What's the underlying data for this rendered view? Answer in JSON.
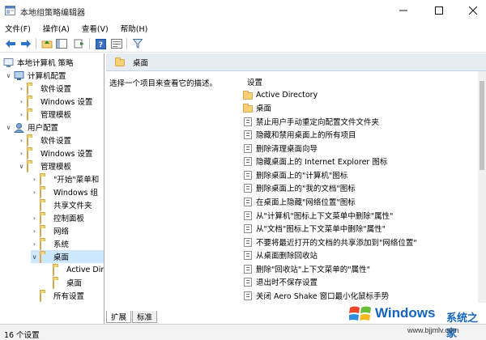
{
  "window": {
    "title": "本地组策略编辑器"
  },
  "menu": [
    "文件(F)",
    "操作(A)",
    "查看(V)",
    "帮助(H)"
  ],
  "tree": {
    "root": "本地计算机 策略",
    "computer_config": "计算机配置",
    "cc_software": "软件设置",
    "cc_windows": "Windows 设置",
    "cc_admin": "管理模板",
    "user_config": "用户配置",
    "uc_software": "软件设置",
    "uc_windows": "Windows 设置",
    "uc_admin": "管理模板",
    "start_menu": "\"开始\"菜单和",
    "windows_components": "Windows 组",
    "shared_folders": "共享文件夹",
    "control_panel": "控制面板",
    "network": "网络",
    "system": "系统",
    "desktop": "桌面",
    "active_dir": "Active Dir",
    "desktop_sub": "桌面",
    "all_settings": "所有设置"
  },
  "header": {
    "title": "桌面"
  },
  "description": "选择一个项目来查看它的描述。",
  "settings": {
    "column_header": "设置",
    "items": [
      {
        "icon": "folder",
        "label": "Active Directory"
      },
      {
        "icon": "folder",
        "label": "桌面"
      },
      {
        "icon": "policy",
        "label": "禁止用户手动重定向配置文件文件夹"
      },
      {
        "icon": "policy",
        "label": "隐藏和禁用桌面上的所有项目"
      },
      {
        "icon": "policy",
        "label": "删除清理桌面向导"
      },
      {
        "icon": "policy",
        "label": "隐藏桌面上的 Internet Explorer 图标"
      },
      {
        "icon": "policy",
        "label": "删除桌面上的\"计算机\"图标"
      },
      {
        "icon": "policy",
        "label": "删除桌面上的\"我的文档\"图标"
      },
      {
        "icon": "policy",
        "label": "在桌面上隐藏\"网络位置\"图标"
      },
      {
        "icon": "policy",
        "label": "从\"计算机\"图标上下文菜单中删除\"属性\""
      },
      {
        "icon": "policy",
        "label": "从\"文档\"图标上下文菜单中删除\"属性\""
      },
      {
        "icon": "policy",
        "label": "不要将最近打开的文档的共享添加到\"网络位置\""
      },
      {
        "icon": "policy",
        "label": "从桌面删除回收站"
      },
      {
        "icon": "policy",
        "label": "删除\"回收站\"上下文菜单的\"属性\""
      },
      {
        "icon": "policy",
        "label": "退出时不保存设置"
      },
      {
        "icon": "policy",
        "label": "关闭 Aero Shake 窗口最小化鼠标手势"
      }
    ]
  },
  "tabs": [
    "扩展",
    "标准"
  ],
  "status": {
    "text": "16 个设置"
  },
  "watermark": {
    "brand": "Windows",
    "cn": "系统之家",
    "url": "www.bjjmlv.com"
  },
  "colors": {
    "selection": "#cce8ff",
    "header_bg": "#e7ecf3",
    "accent": "#1565c0"
  }
}
